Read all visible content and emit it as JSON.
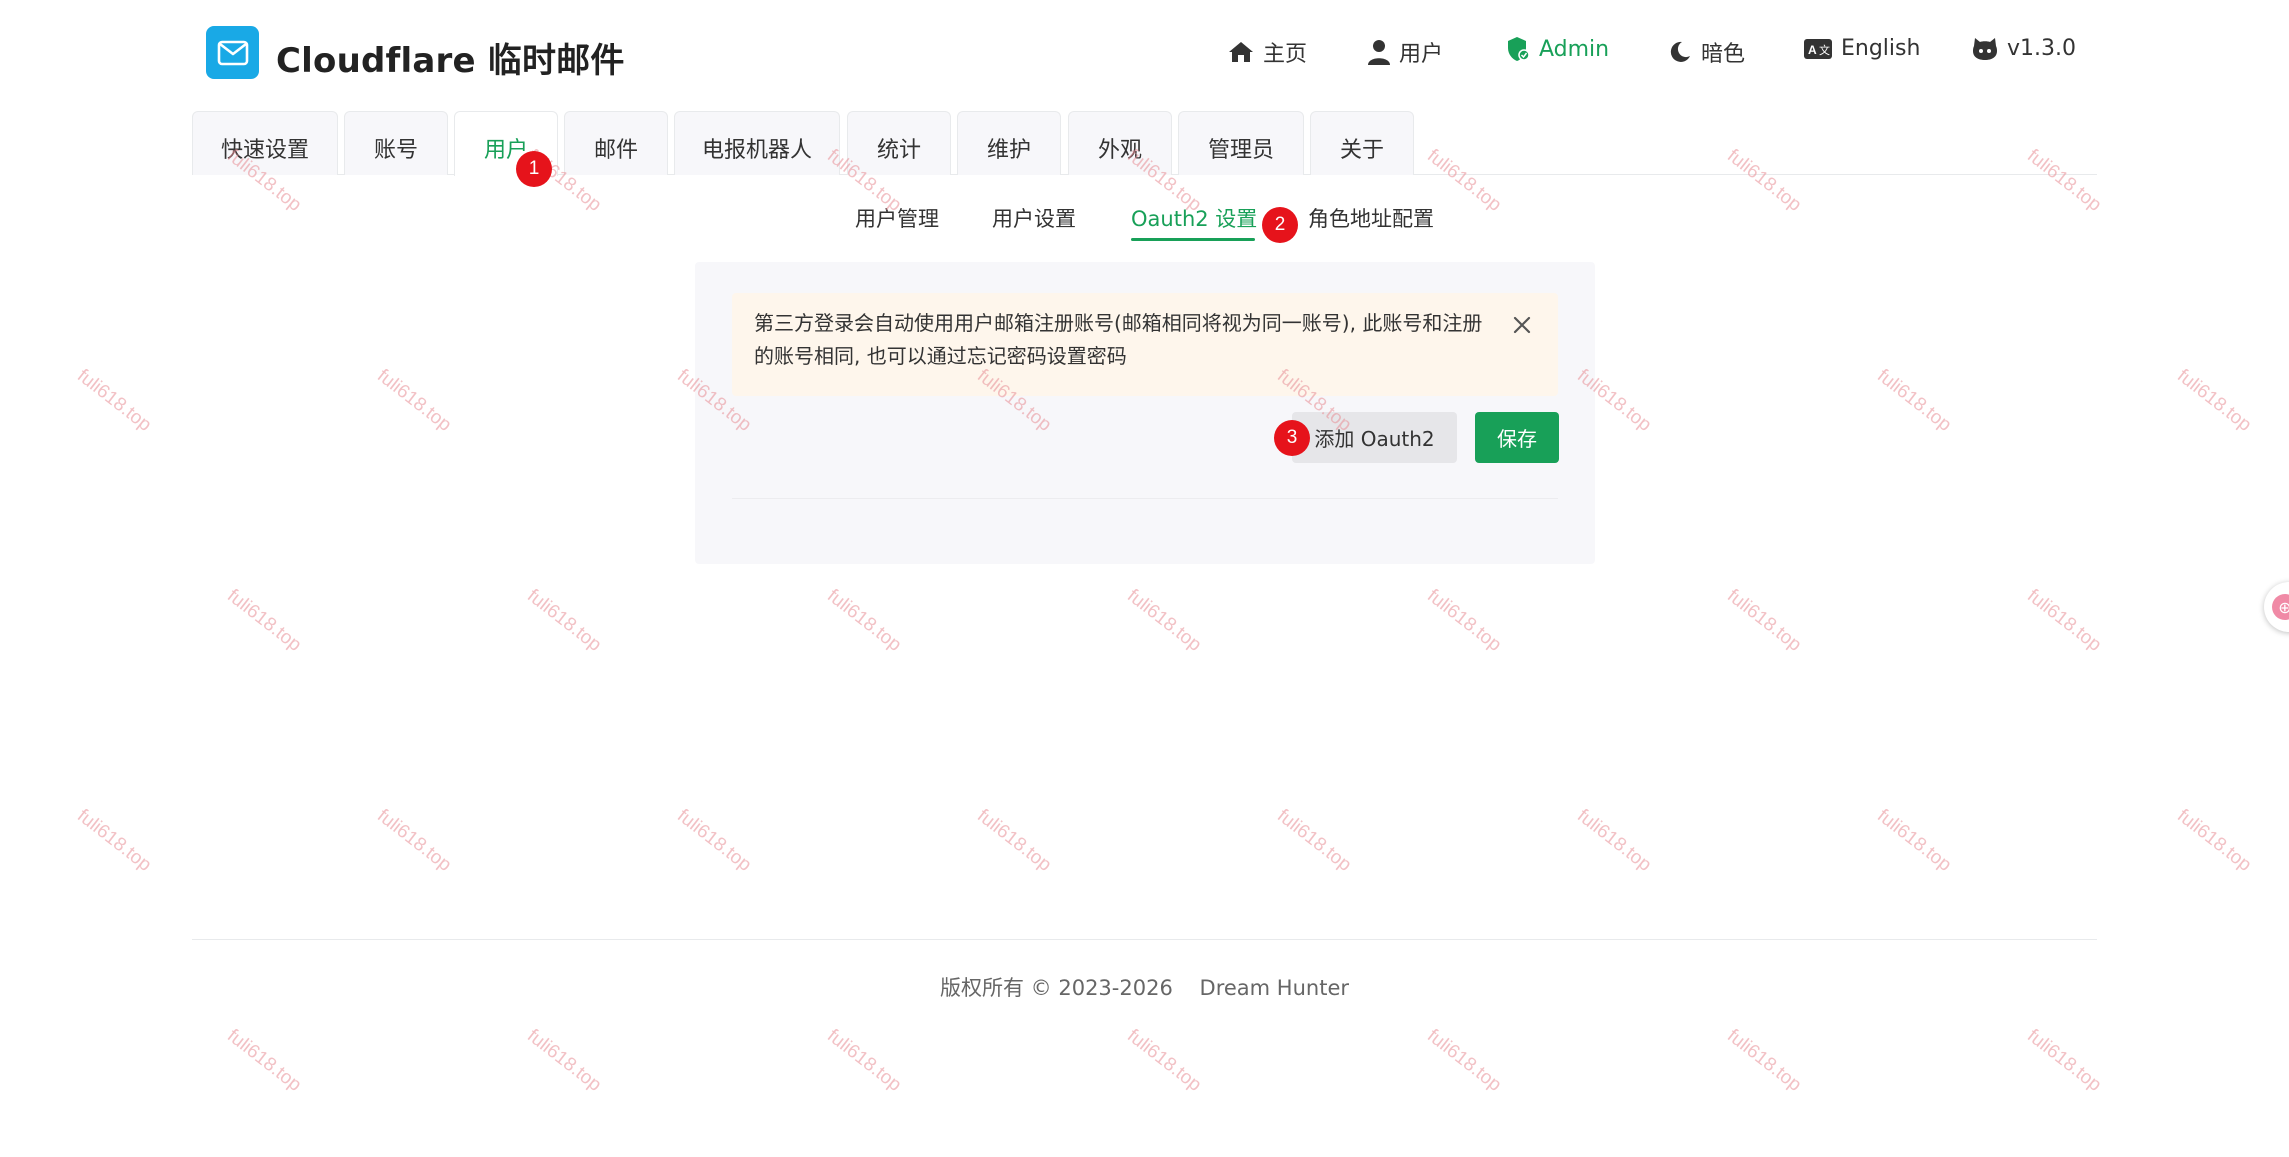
{
  "header": {
    "title": "Cloudflare 临时邮件",
    "nav": [
      {
        "label": "主页",
        "icon": "home-icon"
      },
      {
        "label": "用户",
        "icon": "user-icon"
      },
      {
        "label": "Admin",
        "icon": "shield-icon",
        "active": true
      },
      {
        "label": "暗色",
        "icon": "moon-icon"
      },
      {
        "label": "English",
        "icon": "translate-icon"
      },
      {
        "label": "v1.3.0",
        "icon": "github-icon"
      }
    ]
  },
  "tabs": [
    "快速设置",
    "账号",
    "用户",
    "邮件",
    "电报机器人",
    "统计",
    "维护",
    "外观",
    "管理员",
    "关于"
  ],
  "active_tab": "用户",
  "subtabs": [
    "用户管理",
    "用户设置",
    "Oauth2 设置",
    "角色地址配置"
  ],
  "active_subtab": "Oauth2 设置",
  "alert": {
    "text": "第三方登录会自动使用用户邮箱注册账号(邮箱相同将视为同一账号), 此账号和注册的账号相同, 也可以通过忘记密码设置密码"
  },
  "buttons": {
    "add_label": "添加 Oauth2",
    "save_label": "保存"
  },
  "badges": [
    "1",
    "2",
    "3"
  ],
  "footer": {
    "copyright": "版权所有 © 2023-2026",
    "author": "Dream Hunter"
  },
  "watermark": "fuli618.top",
  "colors": {
    "accent": "#18a058",
    "logo_bg": "#19a9e6",
    "alert_bg": "#fef6ec",
    "badge": "#e6131b"
  }
}
